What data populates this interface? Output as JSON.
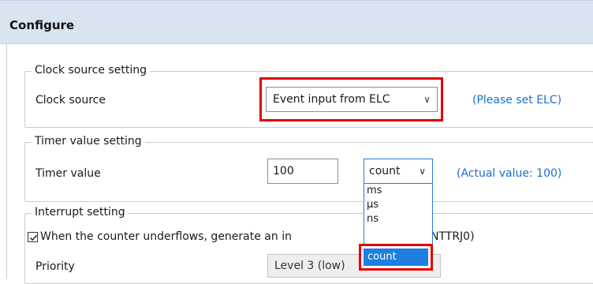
{
  "header": {
    "title": "Configure"
  },
  "clock": {
    "legend": "Clock source setting",
    "label": "Clock source",
    "value": "Event input from ELC",
    "chevron": "∨",
    "note": "(Please set ELC)"
  },
  "timer": {
    "legend": "Timer value setting",
    "label": "Timer value",
    "value": "100",
    "unit": "count",
    "chevron": "∨",
    "note": "(Actual value: 100)",
    "options": [
      "ms",
      "µs",
      "ns",
      "count"
    ],
    "selected_option": "count"
  },
  "interrupt": {
    "legend": "Interrupt setting",
    "checkbox_text_left": "When the counter underflows, generate an in",
    "checkbox_text_right": "NTTRJ0)",
    "checked": true,
    "priority_label": "Priority",
    "priority_value": "Level 3 (low)"
  },
  "colors": {
    "header_bg": "#d9e4f1",
    "highlight_red": "#e00000",
    "link_blue": "#1a6fd1",
    "selection_blue": "#1f7fe0"
  }
}
